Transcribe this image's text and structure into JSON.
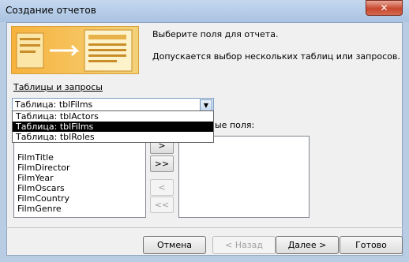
{
  "window": {
    "title": "Создание отчетов",
    "close": "✕"
  },
  "instructions": {
    "line1": "Выберите поля для отчета.",
    "line2": "Допускается выбор нескольких таблиц или запросов."
  },
  "tables_label": "Таблицы и запросы",
  "table_combo": {
    "selected": "Таблица: tblFilms",
    "options": [
      "Таблица: tblActors",
      "Таблица: tblFilms",
      "Таблица: tblRoles"
    ]
  },
  "selected_fields_label": "ые поля:",
  "available_fields": [
    "FilmTitle",
    "FilmDirector",
    "FilmYear",
    "FilmOscars",
    "FilmCountry",
    "FilmGenre"
  ],
  "move_buttons": {
    "add": ">",
    "add_all": ">>",
    "remove": "<",
    "remove_all": "<<"
  },
  "footer": {
    "cancel": "Отмена",
    "back": "< Назад",
    "next": "Далее >",
    "finish": "Готово"
  },
  "colors": {
    "selection": "#000000",
    "banner": "#f7b23d",
    "titlebar": "#b8cde4"
  }
}
